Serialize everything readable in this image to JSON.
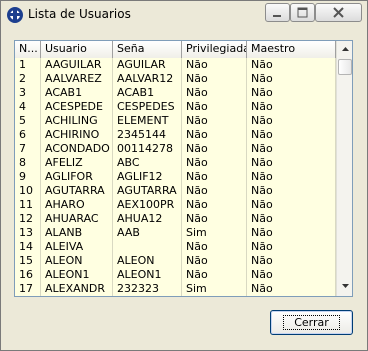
{
  "window": {
    "title": "Lista de Usuarios"
  },
  "grid": {
    "columns": [
      "N...",
      "Usuario",
      "Seña",
      "Privilegiada",
      "Maestro"
    ],
    "rows": [
      [
        "1",
        "AAGUILAR",
        "AGUILAR",
        "Não",
        "Não"
      ],
      [
        "2",
        "AALVAREZ",
        "AALVAR12",
        "Não",
        "Não"
      ],
      [
        "3",
        "ACAB1",
        "ACAB1",
        "Não",
        "Não"
      ],
      [
        "4",
        "ACESPEDE",
        "CESPEDES",
        "Não",
        "Não"
      ],
      [
        "5",
        "ACHILING",
        "ELEMENT",
        "Não",
        "Não"
      ],
      [
        "6",
        "ACHIRINO",
        "2345144",
        "Não",
        "Não"
      ],
      [
        "7",
        "ACONDADO",
        "00114278",
        "Não",
        "Não"
      ],
      [
        "8",
        "AFELIZ",
        "ABC",
        "Não",
        "Não"
      ],
      [
        "9",
        "AGLIFOR",
        "AGLIF12",
        "Não",
        "Não"
      ],
      [
        "10",
        "AGUTARRA",
        "AGUTARRA",
        "Não",
        "Não"
      ],
      [
        "11",
        "AHARO",
        "AEX100PR",
        "Não",
        "Não"
      ],
      [
        "12",
        "AHUARAC",
        "AHUA12",
        "Não",
        "Não"
      ],
      [
        "13",
        "ALANB",
        "AAB",
        "Sim",
        "Não"
      ],
      [
        "14",
        "ALEIVA",
        "",
        "Não",
        "Não"
      ],
      [
        "15",
        "ALEON",
        "ALEON",
        "Não",
        "Não"
      ],
      [
        "16",
        "ALEON1",
        "ALEON1",
        "Não",
        "Não"
      ],
      [
        "17",
        "ALEXANDR",
        "232323",
        "Sim",
        "Não"
      ]
    ]
  },
  "footer": {
    "close_label": "Cerrar"
  },
  "colors": {
    "grid_background": "#ffffe1",
    "window_background": "#ece9d8",
    "button_border": "#003c74"
  },
  "icons": {
    "app": "app-icon",
    "minimize": "minimize-icon",
    "maximize": "maximize-icon",
    "close": "close-icon"
  }
}
